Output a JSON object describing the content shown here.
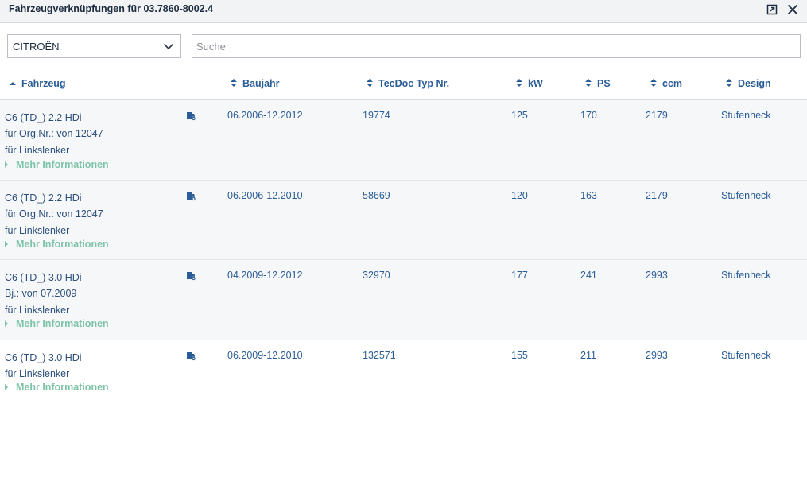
{
  "window": {
    "title": "Fahrzeugverknüpfungen für 03.7860-8002.4"
  },
  "filter": {
    "brand": "CITROËN",
    "search_placeholder": "Suche",
    "search_value": ""
  },
  "columns": {
    "fahrzeug": "Fahrzeug",
    "baujahr": "Baujahr",
    "tecdoc": "TecDoc Typ Nr.",
    "kw": "kW",
    "ps": "PS",
    "ccm": "ccm",
    "design": "Design",
    "sorted_column": "Fahrzeug",
    "sort_direction": "ascending"
  },
  "rows": [
    {
      "model": "C6 (TD_) 2.2 HDi",
      "extra": [
        "für Org.Nr.: von 12047",
        "für Linkslenker"
      ],
      "more": "Mehr Informationen",
      "baujahr": "06.2006-12.2012",
      "tecdoc": "19774",
      "kw": "125",
      "ps": "170",
      "ccm": "2179",
      "design": "Stufenheck"
    },
    {
      "model": "C6 (TD_) 2.2 HDi",
      "extra": [
        "für Org.Nr.: von 12047",
        "für Linkslenker"
      ],
      "more": "Mehr Informationen",
      "baujahr": "06.2006-12.2010",
      "tecdoc": "58669",
      "kw": "120",
      "ps": "163",
      "ccm": "2179",
      "design": "Stufenheck"
    },
    {
      "model": "C6 (TD_) 3.0 HDi",
      "extra": [
        "Bj.: von 07.2009",
        "für Linkslenker"
      ],
      "more": "Mehr Informationen",
      "baujahr": "04.2009-12.2012",
      "tecdoc": "32970",
      "kw": "177",
      "ps": "241",
      "ccm": "2993",
      "design": "Stufenheck"
    },
    {
      "model": "C6 (TD_) 3.0 HDi",
      "extra": [
        "für Linkslenker"
      ],
      "more": "Mehr Informationen",
      "baujahr": "06.2009-12.2010",
      "tecdoc": "132571",
      "kw": "155",
      "ps": "211",
      "ccm": "2993",
      "design": "Stufenheck"
    }
  ],
  "icons": {
    "popout": "popout-icon",
    "close": "close-icon",
    "dropdown": "chevron-down-icon",
    "sort_asc": "sort-ascending-icon",
    "sort_both": "sort-icon",
    "vehicle_settings": "car-settings-icon",
    "expand": "expand-triangle-icon"
  },
  "colors": {
    "link": "#2b5d96",
    "more_info": "#7cc3a7",
    "row_alt": "#f6f7f9",
    "titlebar": "#f2f3f5"
  }
}
